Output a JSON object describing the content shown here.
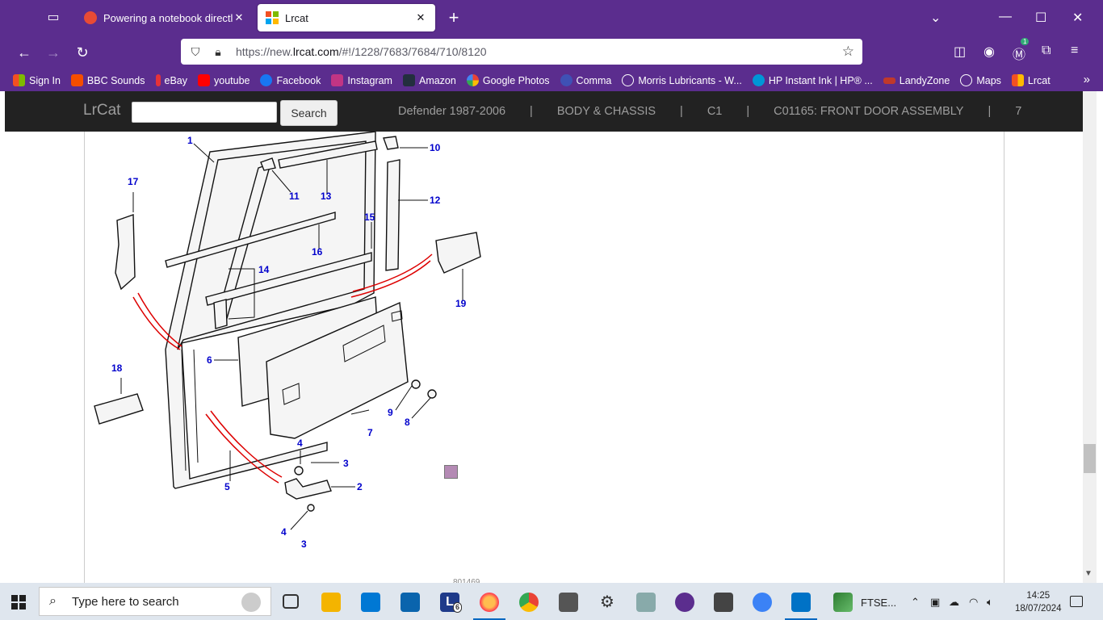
{
  "browser": {
    "tabs": [
      {
        "title": "Powering a notebook directly fr",
        "active": false,
        "favicon_color": "#e94b35"
      },
      {
        "title": "Lrcat",
        "active": true,
        "favicon_color": "#d83b01"
      }
    ],
    "url_prefix": "https://new.",
    "url_domain": "lrcat.com",
    "url_rest": "/#!/1228/7683/7684/710/8120",
    "extension_badge": "1",
    "bookmarks": [
      {
        "label": "Sign In",
        "color": "#f25022"
      },
      {
        "label": "BBC Sounds",
        "color": "#f54e00"
      },
      {
        "label": "eBay",
        "color": "#e53238"
      },
      {
        "label": "youtube",
        "color": "#ff0000"
      },
      {
        "label": "Facebook",
        "color": "#1877f2"
      },
      {
        "label": "Instagram",
        "color": "#c13584"
      },
      {
        "label": "Amazon",
        "color": "#232f3e"
      },
      {
        "label": "Google Photos",
        "color": "#fbbc04"
      },
      {
        "label": "Comma",
        "color": "#3f51b5"
      },
      {
        "label": "Morris Lubricants - W...",
        "color": "#ffffff"
      },
      {
        "label": "HP Instant Ink | HP® ...",
        "color": "#0096d6"
      },
      {
        "label": "LandyZone",
        "color": "#c0392b"
      },
      {
        "label": "Maps",
        "color": "#ffffff"
      },
      {
        "label": "Lrcat",
        "color": "#d83b01"
      }
    ]
  },
  "site": {
    "brand": "LrCat",
    "search_button": "Search",
    "search_placeholder": "",
    "breadcrumb": [
      "Defender 1987-2006",
      "BODY & CHASSIS",
      "C1",
      "C01165: FRONT DOOR ASSEMBLY",
      "7"
    ],
    "breadcrumb_separator": "|",
    "highlighted_part": "7",
    "part_labels": [
      "1",
      "2",
      "3",
      "3",
      "4",
      "4",
      "5",
      "6",
      "7",
      "8",
      "9",
      "10",
      "11",
      "12",
      "13",
      "14",
      "15",
      "16",
      "17",
      "18",
      "19"
    ],
    "footer_partial": "801469"
  },
  "taskbar": {
    "search_placeholder": "Type here to search",
    "pinned_label": "FTSE...",
    "time": "14:25",
    "date": "18/07/2024",
    "badge_count": "6"
  }
}
